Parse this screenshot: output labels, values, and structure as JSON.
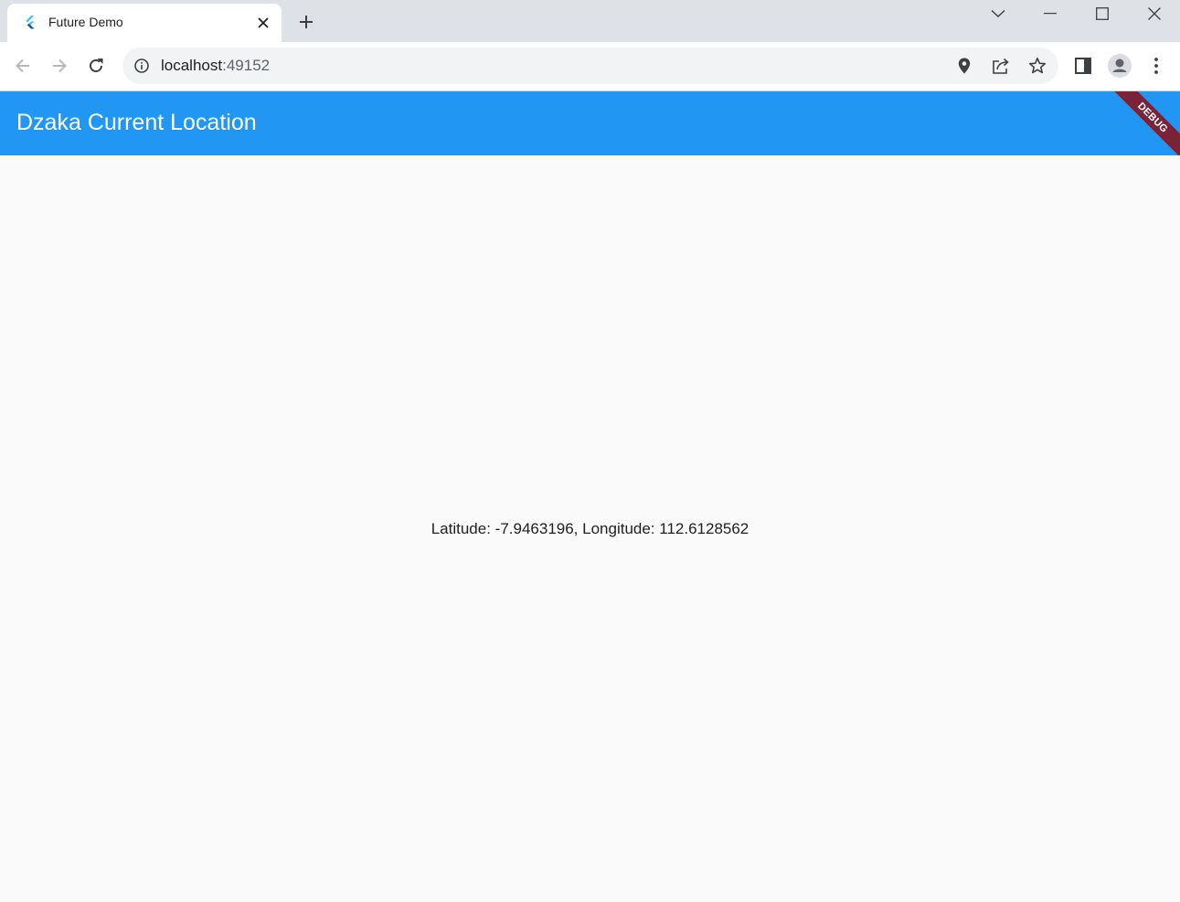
{
  "browser": {
    "tab": {
      "title": "Future Demo",
      "favicon": "flutter-logo-icon"
    },
    "address": {
      "host": "localhost",
      "port": ":49152"
    }
  },
  "app": {
    "title": "Dzaka Current Location",
    "debug_label": "DEBUG",
    "location_text": "Latitude: -7.9463196, Longitude: 112.6128562",
    "colors": {
      "appbar": "#2196f3",
      "background": "#fafafa",
      "debug_banner": "#7a2238"
    }
  }
}
